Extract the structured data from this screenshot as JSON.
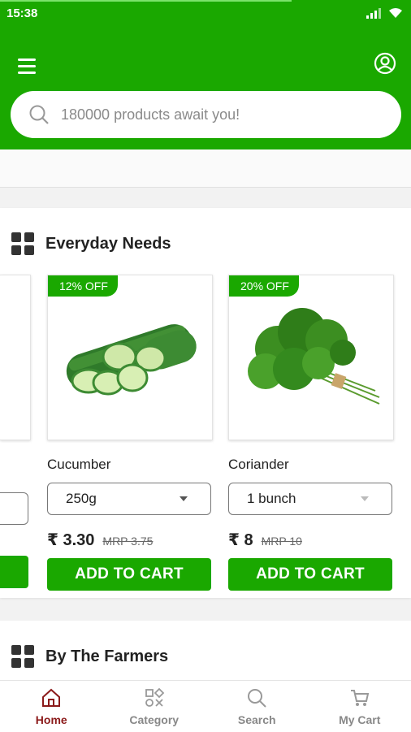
{
  "status_bar": {
    "time": "15:38",
    "load_progress": 0.71
  },
  "header": {
    "search": {
      "placeholder": "180000 products await you!"
    }
  },
  "sections": [
    {
      "title": "Everyday Needs",
      "products": [
        {
          "name": "Cucumber",
          "discount": "12% OFF",
          "quantity": "250g",
          "price": "₹ 3.30",
          "mrp": "MRP 3.75",
          "button": "ADD TO CART"
        },
        {
          "name": "Coriander",
          "discount": "20% OFF",
          "quantity": "1 bunch",
          "price": "₹ 8",
          "mrp": "MRP 10",
          "button": "ADD TO CART"
        }
      ]
    },
    {
      "title": "By The Farmers"
    }
  ],
  "bottom_nav": [
    {
      "label": "Home",
      "icon": "home-icon",
      "active": true
    },
    {
      "label": "Category",
      "icon": "category-icon",
      "active": false
    },
    {
      "label": "Search",
      "icon": "search-icon",
      "active": false
    },
    {
      "label": "My Cart",
      "icon": "cart-icon",
      "active": false
    }
  ],
  "colors": {
    "brand": "#1aa800",
    "active_nav": "#8b1a1a"
  }
}
